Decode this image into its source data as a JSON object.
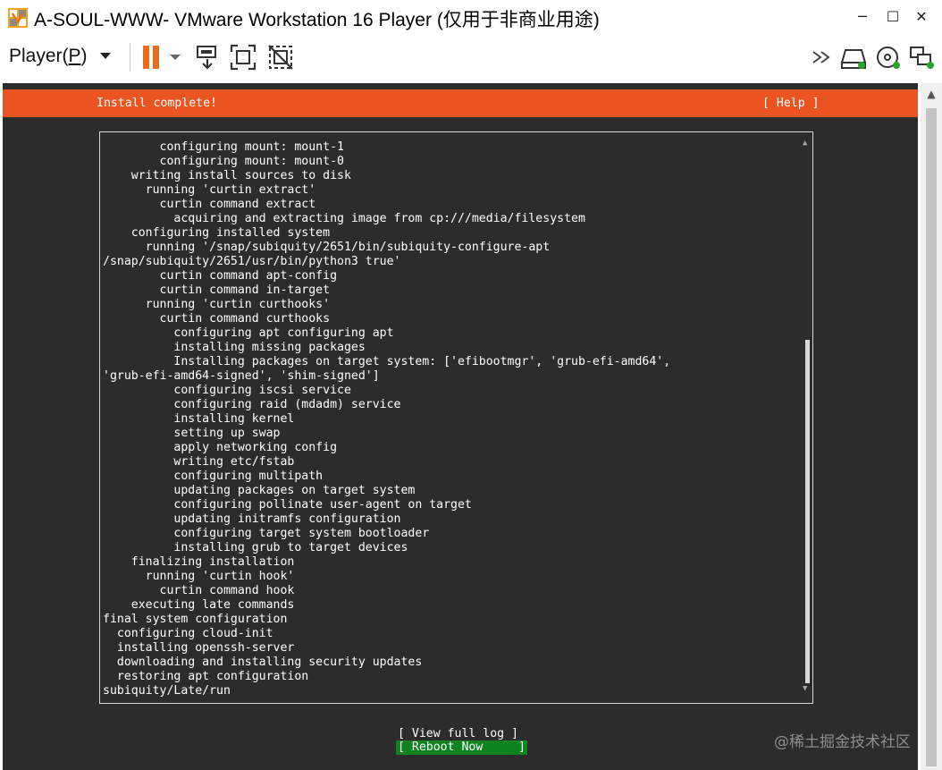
{
  "window": {
    "title": "A-SOUL-WWW- VMware Workstation 16 Player (仅用于非商业用途)",
    "controls": {
      "minimize": "─",
      "maximize": "☐",
      "close": "✕"
    }
  },
  "toolbar": {
    "player_menu_prefix": "Player(",
    "player_menu_key": "P",
    "player_menu_suffix": ")",
    "icons": [
      "pause-icon",
      "send-ctrl-alt-del-icon",
      "fit-guest-icon",
      "unity-icon",
      "forward-icon",
      "hard-disk-icon",
      "cd-dvd-icon",
      "network-adapter-icon"
    ]
  },
  "colors": {
    "header_orange": "#e95420",
    "console_bg": "#2c2c2c",
    "reboot_green": "#0e8420",
    "pause_orange": "#ea6b1a"
  },
  "installer": {
    "header_title": "Install complete!",
    "help_label": "[ Help ]",
    "log_lines": [
      "        configuring mount: mount-1",
      "        configuring mount: mount-0",
      "    writing install sources to disk",
      "      running 'curtin extract'",
      "        curtin command extract",
      "          acquiring and extracting image from cp:///media/filesystem",
      "    configuring installed system",
      "      running '/snap/subiquity/2651/bin/subiquity-configure-apt",
      "/snap/subiquity/2651/usr/bin/python3 true'",
      "        curtin command apt-config",
      "        curtin command in-target",
      "      running 'curtin curthooks'",
      "        curtin command curthooks",
      "          configuring apt configuring apt",
      "          installing missing packages",
      "          Installing packages on target system: ['efibootmgr', 'grub-efi-amd64',",
      "'grub-efi-amd64-signed', 'shim-signed']",
      "          configuring iscsi service",
      "          configuring raid (mdadm) service",
      "          installing kernel",
      "          setting up swap",
      "          apply networking config",
      "          writing etc/fstab",
      "          configuring multipath",
      "          updating packages on target system",
      "          configuring pollinate user-agent on target",
      "          updating initramfs configuration",
      "          configuring target system bootloader",
      "          installing grub to target devices",
      "    finalizing installation",
      "      running 'curtin hook'",
      "        curtin command hook",
      "    executing late commands",
      "final system configuration",
      "  configuring cloud-init",
      "  installing openssh-server",
      "  downloading and installing security updates",
      "  restoring apt configuration",
      "subiquity/Late/run"
    ],
    "scroll_up_glyph": "▲",
    "scroll_down_glyph": "▼",
    "view_log_label": "[ View full log ]",
    "reboot_label": "[ Reboot Now     ]"
  },
  "scrollbar": {
    "up_glyph": "▲"
  },
  "watermark": "@稀土掘金技术社区"
}
